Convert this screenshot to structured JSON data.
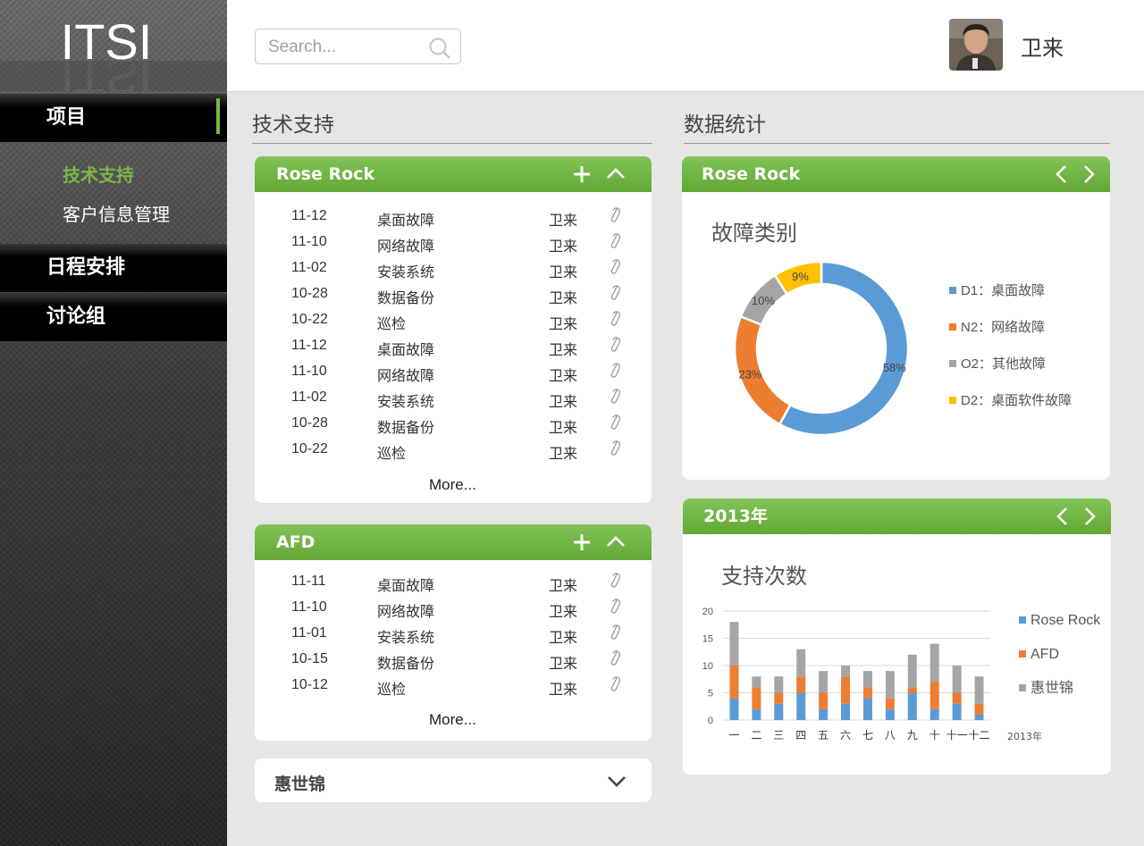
{
  "logo": {
    "text": "ITSI"
  },
  "sidebar": {
    "nav": [
      {
        "label": "项目",
        "active": true
      },
      {
        "label": "日程安排",
        "active": false
      },
      {
        "label": "讨论组",
        "active": false
      }
    ],
    "sub_items": [
      {
        "label": "技术支持",
        "active": true
      },
      {
        "label": "客户信息管理",
        "active": false
      }
    ]
  },
  "header": {
    "search_placeholder": "Search...",
    "user_name": "卫来"
  },
  "tech_section": {
    "title": "技术支持",
    "cards": [
      {
        "title": "Rose Rock",
        "more_label": "More...",
        "rows": [
          {
            "date": "11-12",
            "type": "桌面故障",
            "user": "卫来"
          },
          {
            "date": "11-10",
            "type": "网络故障",
            "user": "卫来"
          },
          {
            "date": "11-02",
            "type": "安装系统",
            "user": "卫来"
          },
          {
            "date": "10-28",
            "type": "数据备份",
            "user": "卫来"
          },
          {
            "date": "10-22",
            "type": "巡检",
            "user": "卫来"
          },
          {
            "date": "11-12",
            "type": "桌面故障",
            "user": "卫来"
          },
          {
            "date": "11-10",
            "type": "网络故障",
            "user": "卫来"
          },
          {
            "date": "11-02",
            "type": "安装系统",
            "user": "卫来"
          },
          {
            "date": "10-28",
            "type": "数据备份",
            "user": "卫来"
          },
          {
            "date": "10-22",
            "type": "巡检",
            "user": "卫来"
          }
        ]
      },
      {
        "title": "AFD",
        "more_label": "More...",
        "rows": [
          {
            "date": "11-11",
            "type": "桌面故障",
            "user": "卫来"
          },
          {
            "date": "11-10",
            "type": "网络故障",
            "user": "卫来"
          },
          {
            "date": "11-01",
            "type": "安装系统",
            "user": "卫来"
          },
          {
            "date": "10-15",
            "type": "数据备份",
            "user": "卫来"
          },
          {
            "date": "10-12",
            "type": "巡检",
            "user": "卫来"
          }
        ]
      },
      {
        "title": "惠世锦",
        "collapsed": true
      }
    ]
  },
  "stats_section": {
    "title": "数据统计",
    "donut_card_title": "Rose Rock",
    "bar_card_title": "2013年"
  },
  "colors": {
    "accent_green": "#6ab23e",
    "blue": "#5b9bd5",
    "orange": "#ed7d31",
    "gray": "#a5a5a5",
    "yellow": "#ffc000"
  },
  "chart_data": [
    {
      "type": "pie",
      "title": "故障类别",
      "donut": true,
      "legend_position": "right",
      "slices": [
        {
          "name": "D1：桌面故障",
          "value": 58,
          "label": "58%",
          "color": "#5b9bd5"
        },
        {
          "name": "N2：网络故障",
          "value": 23,
          "label": "23%",
          "color": "#ed7d31"
        },
        {
          "name": "O2：其他故障",
          "value": 10,
          "label": "10%",
          "color": "#a5a5a5"
        },
        {
          "name": "D2：桌面软件故障",
          "value": 9,
          "label": "9%",
          "color": "#ffc000"
        }
      ]
    },
    {
      "type": "bar",
      "stacked": true,
      "title": "支持次数",
      "xlabel": "2013年",
      "ylabel": "",
      "ylim": [
        0,
        20
      ],
      "yticks": [
        0,
        5,
        10,
        15,
        20
      ],
      "grid": true,
      "legend_position": "right",
      "categories": [
        "一",
        "二",
        "三",
        "四",
        "五",
        "六",
        "七",
        "八",
        "九",
        "十",
        "十一",
        "十二"
      ],
      "series": [
        {
          "name": "Rose Rock",
          "color": "#5b9bd5",
          "values": [
            4,
            2,
            3,
            5,
            2,
            3,
            4,
            2,
            5,
            2,
            3,
            1
          ]
        },
        {
          "name": "AFD",
          "color": "#ed7d31",
          "values": [
            6,
            4,
            2,
            3,
            3,
            5,
            2,
            2,
            1,
            5,
            2,
            2
          ]
        },
        {
          "name": "惠世锦",
          "color": "#a5a5a5",
          "values": [
            8,
            2,
            3,
            5,
            4,
            2,
            3,
            5,
            6,
            7,
            5,
            5
          ]
        }
      ]
    }
  ]
}
